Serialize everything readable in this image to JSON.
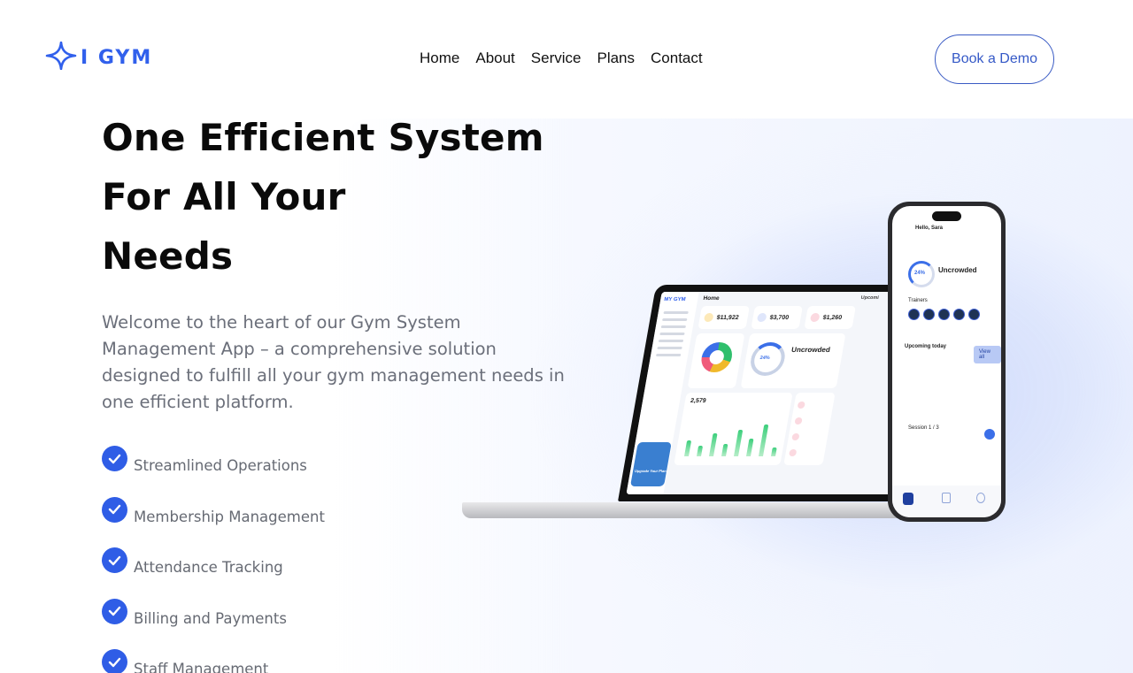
{
  "brand": {
    "logo_text": "I GYM",
    "accent": "#3160ec"
  },
  "nav": {
    "items": [
      "Home",
      "About",
      "Service",
      "Plans",
      "Contact"
    ]
  },
  "cta": {
    "label": "Book a Demo"
  },
  "hero": {
    "title_lines": [
      "One Efficient System",
      "For All Your",
      "Needs"
    ],
    "description": "Welcome to the heart of our Gym System Management App – a comprehensive solution designed to fulfill all your gym management needs in one efficient platform."
  },
  "features": [
    "Streamlined Operations",
    "Membership Management",
    "Attendance Tracking",
    "Billing and Payments",
    "Staff Management"
  ],
  "laptop_mock": {
    "brand": "MY GYM",
    "page": "Home",
    "stats": [
      "$11,922",
      "$3,700",
      "$1,260"
    ],
    "status_title": "Uncrowded",
    "status_percent": "24%",
    "chart_value": "2,579",
    "upcoming_label": "Upcomi",
    "upgrade_label": "Upgrade Your Plan"
  },
  "phone_mock": {
    "greeting": "Hello, Sara",
    "status_title": "Uncrowded",
    "status_percent": "24%",
    "section_trainers": "Trainers",
    "section_upcoming": "Upcoming today",
    "view_all": "View all",
    "session_label": "Session 1 / 3"
  }
}
